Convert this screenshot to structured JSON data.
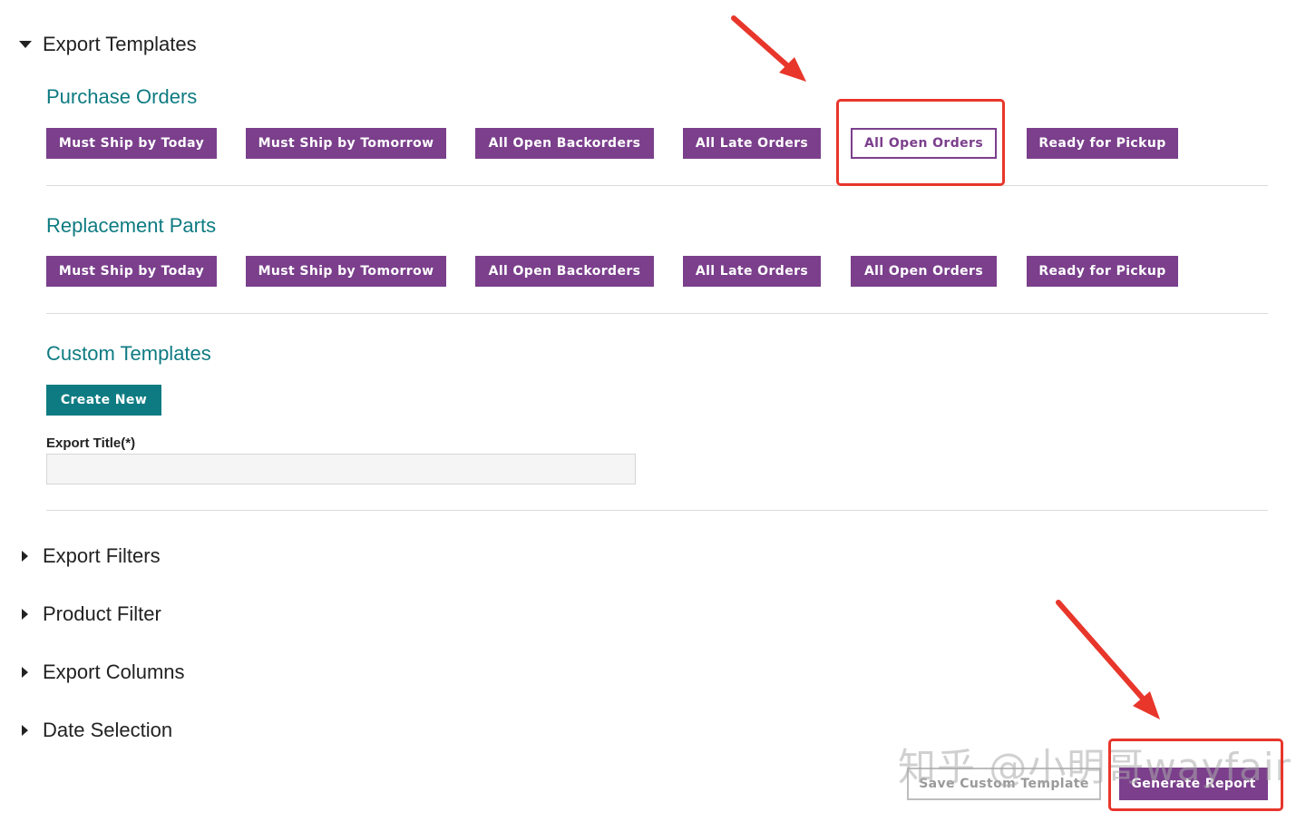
{
  "export_templates": {
    "title": "Export Templates",
    "expanded": true
  },
  "purchase_orders": {
    "title": "Purchase Orders",
    "buttons": [
      "Must Ship by Today",
      "Must Ship by Tomorrow",
      "All Open Backorders",
      "All Late Orders",
      "All Open Orders",
      "Ready for Pickup"
    ],
    "selected": "All Open Orders"
  },
  "replacement_parts": {
    "title": "Replacement Parts",
    "buttons": [
      "Must Ship by Today",
      "Must Ship by Tomorrow",
      "All Open Backorders",
      "All Late Orders",
      "All Open Orders",
      "Ready for Pickup"
    ]
  },
  "custom_templates": {
    "title": "Custom Templates",
    "create_new_label": "Create New",
    "export_title_label": "Export Title(*)",
    "export_title_value": ""
  },
  "collapsed_sections": [
    "Export Filters",
    "Product Filter",
    "Export Columns",
    "Date Selection"
  ],
  "footer": {
    "save_template_label": "Save Custom Template",
    "generate_report_label": "Generate Report"
  },
  "watermark": "知乎 @小明哥wayfair",
  "colors": {
    "purple": "#7b3f8c",
    "teal": "#0e7b82",
    "annotation_red": "#e8362b"
  }
}
